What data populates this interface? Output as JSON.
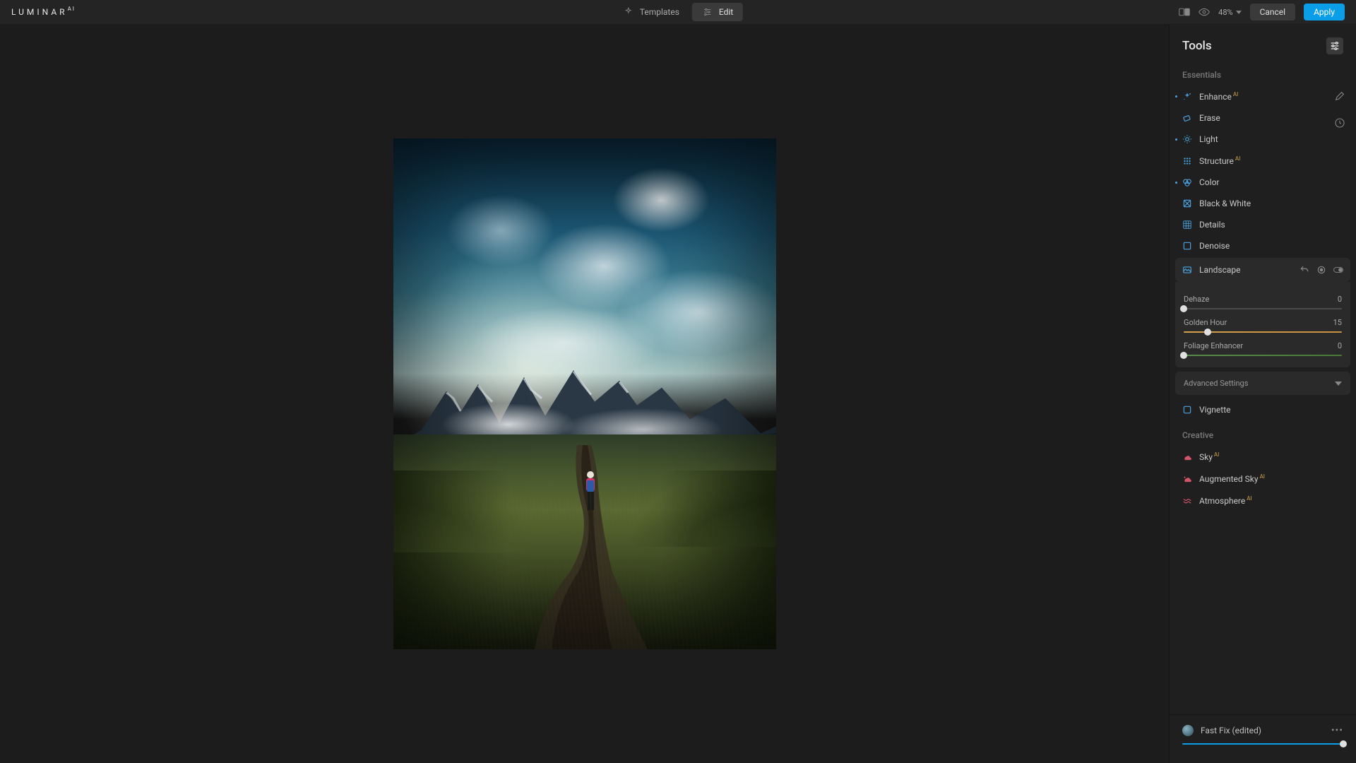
{
  "app": {
    "logo_main": "LUMINAR",
    "logo_sup": "AI"
  },
  "topbar": {
    "templates_label": "Templates",
    "edit_label": "Edit",
    "zoom": "48%",
    "cancel_label": "Cancel",
    "apply_label": "Apply"
  },
  "panel": {
    "title": "Tools",
    "sections": {
      "essentials": "Essentials",
      "creative": "Creative"
    },
    "tools_essentials": [
      {
        "name": "Enhance",
        "ai": true,
        "dot": true,
        "icon": "sparkle"
      },
      {
        "name": "Erase",
        "ai": false,
        "dot": false,
        "icon": "erase"
      },
      {
        "name": "Light",
        "ai": false,
        "dot": true,
        "icon": "sun"
      },
      {
        "name": "Structure",
        "ai": true,
        "dot": false,
        "icon": "grid"
      },
      {
        "name": "Color",
        "ai": false,
        "dot": true,
        "icon": "palette"
      },
      {
        "name": "Black & White",
        "ai": false,
        "dot": false,
        "icon": "bw"
      },
      {
        "name": "Details",
        "ai": false,
        "dot": false,
        "icon": "details"
      },
      {
        "name": "Denoise",
        "ai": false,
        "dot": false,
        "icon": "denoise"
      }
    ],
    "landscape": {
      "name": "Landscape",
      "sliders": [
        {
          "label": "Dehaze",
          "value": 0,
          "min": 0,
          "max": 100,
          "style": "plain"
        },
        {
          "label": "Golden Hour",
          "value": 15,
          "min": 0,
          "max": 100,
          "style": "golden"
        },
        {
          "label": "Foliage Enhancer",
          "value": 0,
          "min": 0,
          "max": 100,
          "style": "green"
        }
      ],
      "advanced_label": "Advanced Settings"
    },
    "vignette": {
      "name": "Vignette"
    },
    "tools_creative": [
      {
        "name": "Sky",
        "ai": true,
        "icon": "cloud"
      },
      {
        "name": "Augmented Sky",
        "ai": true,
        "icon": "cloud2"
      },
      {
        "name": "Atmosphere",
        "ai": true,
        "icon": "waves"
      }
    ]
  },
  "preset": {
    "name": "Fast Fix (edited)",
    "amount": 100
  }
}
